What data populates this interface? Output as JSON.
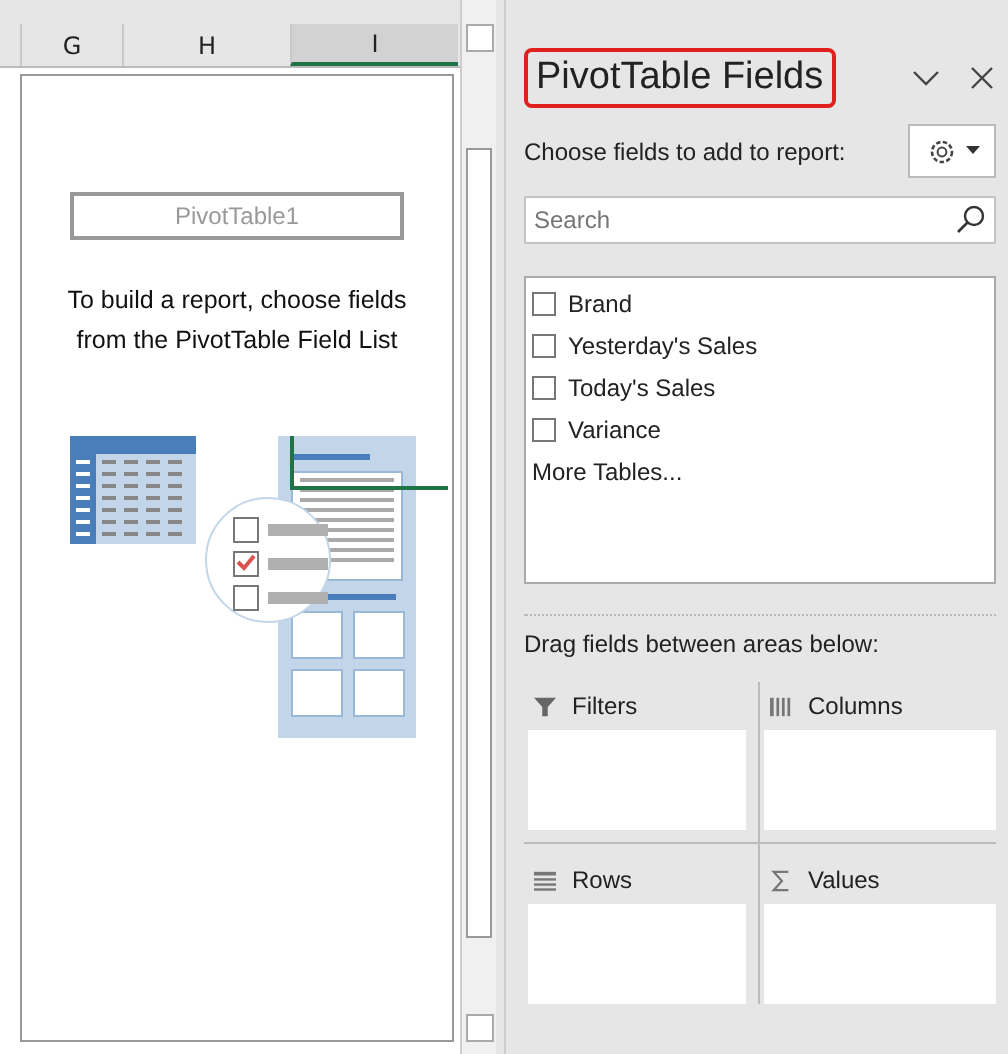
{
  "sheet": {
    "columns": [
      {
        "label": "G",
        "selected": false
      },
      {
        "label": "H",
        "selected": false
      },
      {
        "label": "I",
        "selected": true
      }
    ],
    "placeholder": {
      "name": "PivotTable1",
      "instructions": "To build a report, choose fields from the PivotTable Field List"
    }
  },
  "panel": {
    "title": "PivotTable Fields",
    "prompt": "Choose fields to add to report:",
    "search": {
      "placeholder": "Search"
    },
    "fields": [
      {
        "label": "Brand",
        "checked": false
      },
      {
        "label": "Yesterday's Sales",
        "checked": false
      },
      {
        "label": "Today's Sales",
        "checked": false
      },
      {
        "label": "Variance",
        "checked": false
      }
    ],
    "more_link": "More Tables...",
    "areas_prompt": "Drag fields between areas below:",
    "areas": [
      {
        "label": "Filters",
        "kind": "filters"
      },
      {
        "label": "Columns",
        "kind": "columns"
      },
      {
        "label": "Rows",
        "kind": "rows"
      },
      {
        "label": "Values",
        "kind": "values"
      }
    ]
  }
}
